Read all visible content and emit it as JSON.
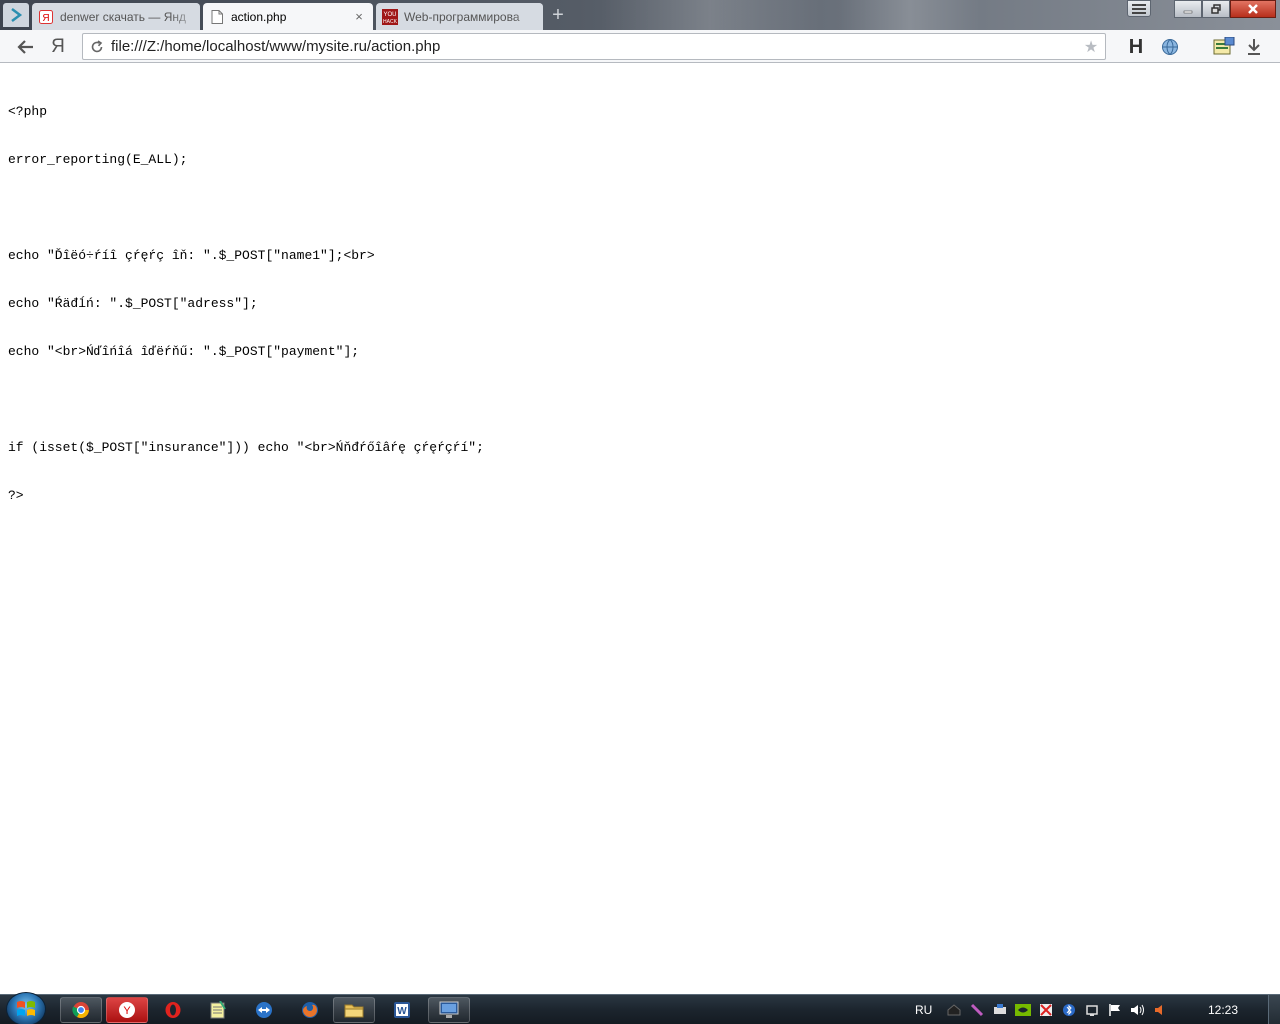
{
  "browser": {
    "tabs": [
      {
        "label": "denwer скачать — Янд",
        "favicon": "yandex-icon",
        "active": false
      },
      {
        "label": "action.php",
        "favicon": "file-icon",
        "active": true
      },
      {
        "label": "Web-программирова",
        "favicon": "youhack-icon",
        "active": false
      }
    ],
    "new_tab_label": "+",
    "close_label": "×",
    "address": {
      "url": "file:///Z:/home/localhost/www/mysite.ru/action.php",
      "star_label": "★"
    },
    "toolbar_icons": [
      "back-arrow-icon",
      "yandex-icon",
      "reload-icon",
      "star-icon",
      "hm-extension-icon",
      "globe-icon",
      "translate-icon",
      "download-icon"
    ],
    "yandex_label": "Я",
    "h_label": "H"
  },
  "page": {
    "code_lines": [
      "<?php",
      "error_reporting(E_ALL);",
      "",
      "echo \"Ďîëó÷ŕíî çŕęŕç îň: \".$_POST[\"name1\"];<br>",
      "echo \"Ŕäđĺń: \".$_POST[\"adress\"];",
      "echo \"<br>Ńďîńîá îďëŕňű: \".$_POST[\"payment\"];",
      "",
      "if (isset($_POST[\"insurance\"])) echo \"<br>Ńňđŕőîâŕę çŕęŕçŕí\";",
      "?>"
    ]
  },
  "taskbar": {
    "apps": [
      "chrome-icon",
      "yandex-browser-icon",
      "opera-icon",
      "notepad-icon",
      "teamviewer-icon",
      "firefox-icon",
      "explorer-folder-icon",
      "word-icon",
      "remote-desktop-icon"
    ],
    "language": "RU",
    "clock": "12:23",
    "tray_icons": [
      "network-icon",
      "pen-icon",
      "printer-icon",
      "nvidia-icon",
      "security-icon",
      "bluetooth-icon",
      "device-icon",
      "flag-icon",
      "volume-icon",
      "speaker-muted-icon"
    ]
  }
}
